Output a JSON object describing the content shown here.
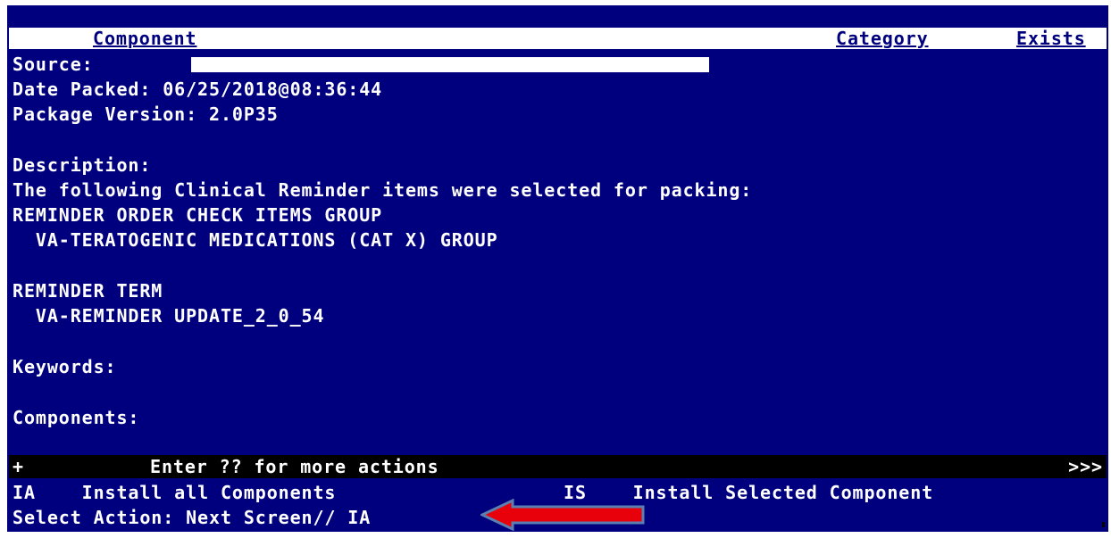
{
  "header": {
    "component": "Component",
    "category": "Category",
    "exists": "Exists"
  },
  "details": {
    "source_label": "Source:",
    "date_packed": "Date Packed: 06/25/2018@08:36:44",
    "package_version": "Package Version: 2.0P35",
    "description_label": "Description:",
    "description_line1": "The following Clinical Reminder items were selected for packing:",
    "group_heading": "REMINDER ORDER CHECK ITEMS GROUP",
    "group_item": "  VA-TERATOGENIC MEDICATIONS (CAT X) GROUP",
    "term_heading": "REMINDER TERM",
    "term_item": "  VA-REMINDER UPDATE_2_0_54",
    "keywords_label": "Keywords:",
    "components_label": "Components:"
  },
  "action_bar": {
    "plus": "+",
    "hint": "Enter ?? for more actions",
    "more": ">>>"
  },
  "actions": [
    {
      "code": "IA",
      "label": "Install all Components"
    },
    {
      "code": "IS",
      "label": "Install Selected Component"
    }
  ],
  "prompt": {
    "text": "Select Action: Next Screen// IA"
  },
  "colors": {
    "terminal_bg": "#00007f",
    "arrow": "#e8000b"
  }
}
